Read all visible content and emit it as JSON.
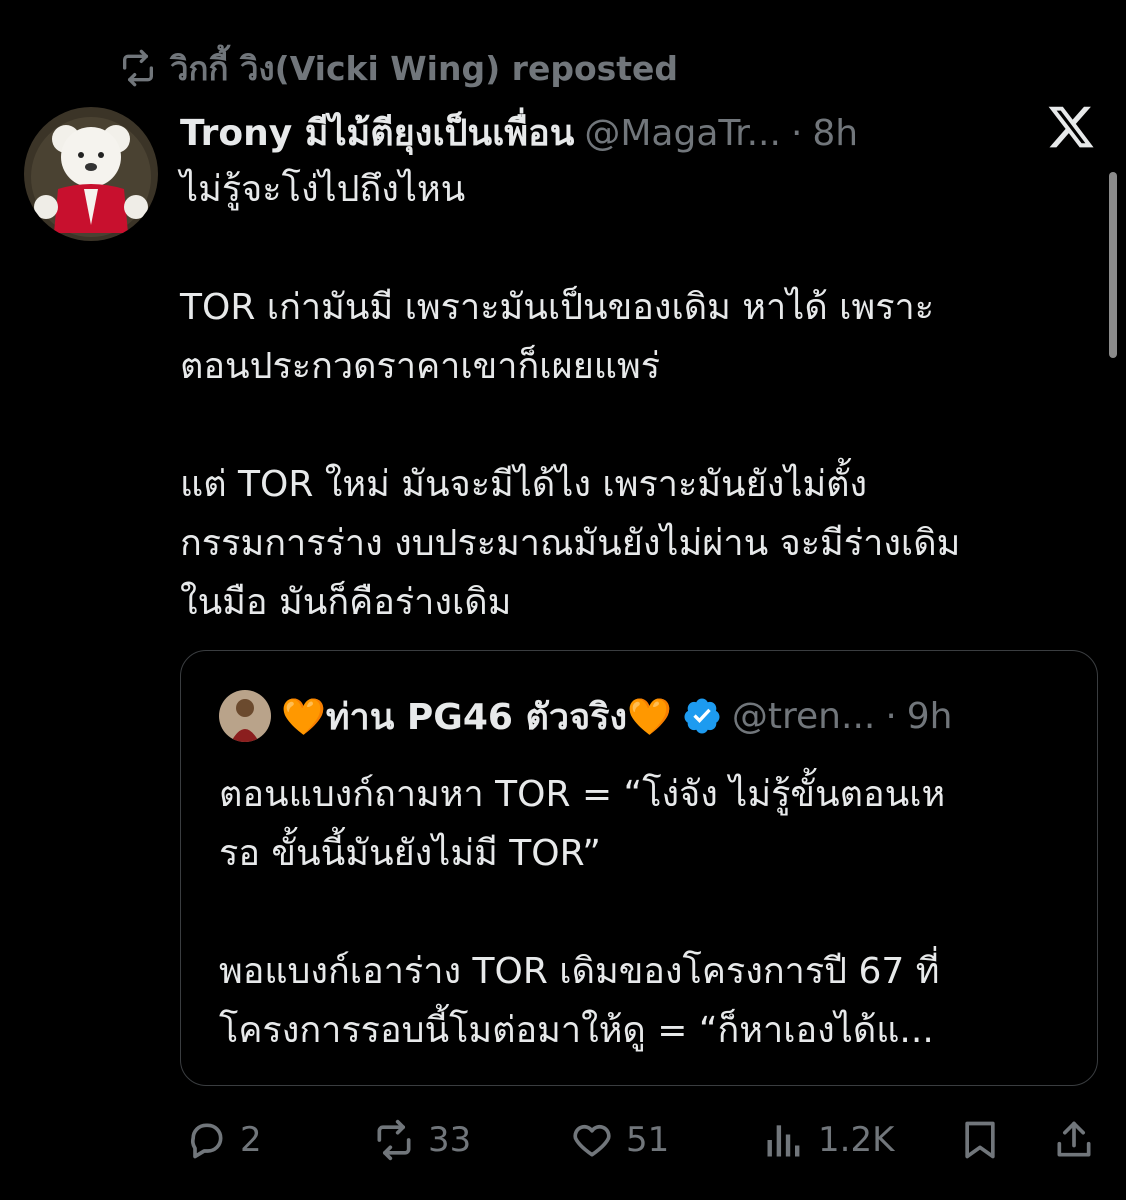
{
  "repost": {
    "icon": "repost-icon",
    "text": "วิกกี้ วิง(Vicki Wing) reposted"
  },
  "tweet": {
    "author_name": "Trony มีไม้ตียุงเป็นเพื่อน",
    "handle": "@MagaTr...",
    "dot": "·",
    "time": "8h",
    "text": "ไม่รู้จะโง่ไปถึงไหน\n\nTOR เก่ามันมี เพราะมันเป็นของเดิม หาได้ เพราะ\nตอนประกวดราคาเขาก็เผยแพร่\n\nแต่  TOR ใหม่ มันจะมีได้ไง เพราะมันยังไม่ตั้ง\nกรรมการร่าง งบประมาณมันยังไม่ผ่าน จะมีร่างเดิม\nในมือ มันก็คือร่างเดิม"
  },
  "quote": {
    "name": "🧡ท่าน PG46 ตัวจริง🧡",
    "verified_icon": "verified-badge-icon",
    "handle": "@tren...",
    "dot": "·",
    "time": "9h",
    "text": "ตอนแบงก์ถามหา TOR = “โง่จัง ไม่รู้ขั้นตอนเห\nรอ ขั้นนี้มันยังไม่มี TOR”\n\nพอแบงก์เอาร่าง TOR เดิมของโครงการปี 67 ที่\nโครงการรอบนี้โมต่อมาให้ดู = “ก็หาเองได้แ..."
  },
  "actions": {
    "reply_count": "2",
    "repost_count": "33",
    "like_count": "51",
    "view_count": "1.2K"
  },
  "colors": {
    "background": "#000000",
    "text": "#e7e9ea",
    "muted": "#71767b",
    "verified": "#1d9bf0"
  }
}
